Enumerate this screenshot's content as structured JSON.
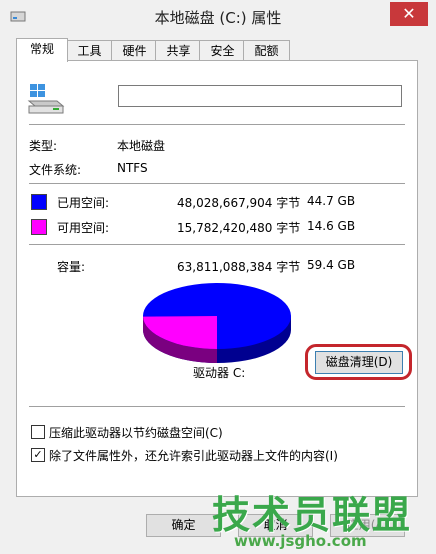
{
  "window": {
    "title": "本地磁盘 (C:) 属性",
    "close_glyph": "✕"
  },
  "tabs": [
    "常规",
    "工具",
    "硬件",
    "共享",
    "安全",
    "配额"
  ],
  "general": {
    "drive_name_value": "",
    "type_label": "类型:",
    "type_value": "本地磁盘",
    "fs_label": "文件系统:",
    "fs_value": "NTFS",
    "used_label": "已用空间:",
    "used_bytes": "48,028,667,904 字节",
    "used_gb": "44.7 GB",
    "free_label": "可用空间:",
    "free_bytes": "15,782,420,480 字节",
    "free_gb": "14.6 GB",
    "capacity_label": "容量:",
    "capacity_bytes": "63,811,088,384 字节",
    "capacity_gb": "59.4 GB",
    "drive_label": "驱动器 C:",
    "cleanup_button": "磁盘清理(D)",
    "compress_label": "压缩此驱动器以节约磁盘空间(C)",
    "compress_checked": false,
    "index_label": "除了文件属性外，还允许索引此驱动器上文件的内容(I)",
    "index_checked": true
  },
  "colors": {
    "used": "#0000ff",
    "free": "#ff00ff"
  },
  "pie_used_fraction": 0.753,
  "footer": {
    "ok": "确定",
    "cancel": "取消",
    "apply": "应用(A)"
  },
  "watermark": {
    "line1": "技术员联盟",
    "line2": "www.jsgho.com"
  }
}
